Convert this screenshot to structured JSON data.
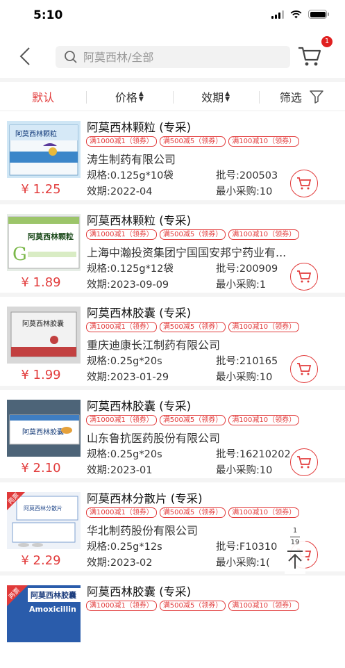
{
  "status": {
    "time": "5:10"
  },
  "header": {
    "search_placeholder": "阿莫西林/全部",
    "cart_badge": "1"
  },
  "filters": [
    {
      "label": "默认",
      "active": true
    },
    {
      "label": "价格"
    },
    {
      "label": "效期"
    },
    {
      "label": "筛选"
    }
  ],
  "products": [
    {
      "name": "阿莫西林颗粒 (专采)",
      "coupons": [
        "满1000减1（领券）",
        "满500减5（领券）",
        "满100减10（领券）"
      ],
      "maker": "涛生制药有限公司",
      "spec": "规格:0.125g*10袋",
      "batch": "批号:200503",
      "expiry": "效期:2022-04",
      "min": "最小采购:10",
      "price": "¥ 1.25"
    },
    {
      "name": "阿莫西林颗粒 (专采)",
      "coupons": [
        "满1000减1（领券）",
        "满500减5（领券）",
        "满100减10（领券）"
      ],
      "maker": "上海中瀚投资集团宁国国安邦宁药业有...",
      "spec": "规格:0.125g*12袋",
      "batch": "批号:200909",
      "expiry": "效期:2023-09-09",
      "min": "最小采购:1",
      "price": "¥ 1.89"
    },
    {
      "name": "阿莫西林胶囊 (专采)",
      "coupons": [
        "满1000减1（领券）",
        "满500减5（领券）",
        "满100减10（领券）"
      ],
      "maker": "重庆迪康长江制药有限公司",
      "spec": "规格:0.25g*20s",
      "batch": "批号:210165",
      "expiry": "效期:2023-01-29",
      "min": "最小采购:10",
      "price": "¥ 1.99"
    },
    {
      "name": "阿莫西林胶囊 (专采)",
      "coupons": [
        "满1000减1（领券）",
        "满500减5（领券）",
        "满100减10（领券）"
      ],
      "maker": "山东鲁抗医药股份有限公司",
      "spec": "规格:0.25g*20s",
      "batch": "批号:16210202",
      "expiry": "效期:2023-01",
      "min": "最小采购:10",
      "price": "¥ 2.10"
    },
    {
      "name": "阿莫西林分散片 (专采)",
      "coupons": [
        "满1000减1（领券）",
        "满500减5（领券）",
        "满100减10（领券）"
      ],
      "maker": "华北制药股份有限公司",
      "spec": "规格:0.25g*12s",
      "batch": "批号:F10310",
      "expiry": "效期:2023-02",
      "min": "最小采购:1(",
      "price": "¥ 2.29"
    },
    {
      "name": "阿莫西林胶囊 (专采)",
      "coupons": [
        "满1000减1（领券）",
        "满500减5（领券）",
        "满100减10（领券）"
      ],
      "maker": "",
      "spec": "",
      "batch": "",
      "expiry": "",
      "min": "",
      "price": ""
    }
  ],
  "thumb_labels": {
    "p1": "阿莫西林颗粒",
    "p2": "阿莫西林颗粒",
    "p3": "阿莫西林胶囊",
    "p4": "阿莫西林胶囊",
    "p5": "阿莫西林分散片",
    "p5_tag": "两票",
    "p6": "阿莫西林胶囊",
    "p6_tag": "两票",
    "p6_en": "Amoxicillin"
  },
  "pager": {
    "current": "1",
    "total": "19"
  },
  "colors": {
    "accent": "#e23c3c"
  }
}
